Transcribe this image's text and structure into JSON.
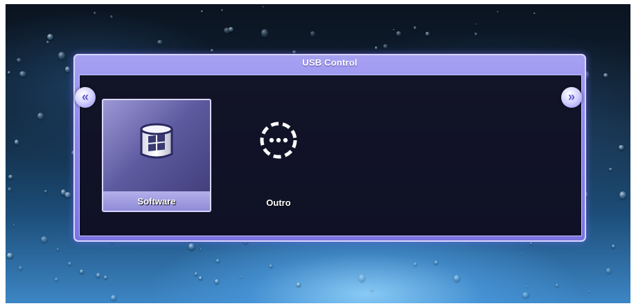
{
  "dialog": {
    "title": "USB Control"
  },
  "menu": {
    "items": [
      {
        "label": "Software",
        "icon": "usb-drive-windows-icon",
        "selected": true
      },
      {
        "label": "Outro",
        "icon": "dotted-circle-more-icon",
        "selected": false
      }
    ]
  },
  "navigation": {
    "left_icon": "chevron-double-left-icon",
    "right_icon": "chevron-double-right-icon"
  },
  "colors": {
    "panel_border": "#8d87ea",
    "panel_background": "#080a18",
    "selection": "#8f8bd8",
    "text": "#ffffff"
  }
}
